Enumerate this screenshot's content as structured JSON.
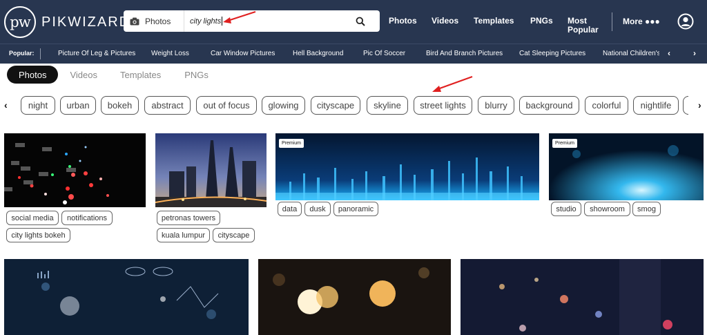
{
  "brand": {
    "logo_mark": "pw",
    "name": "PIKWIZARD"
  },
  "search": {
    "type_label": "Photos",
    "query": "city lights",
    "camera_icon": "camera-icon",
    "search_icon": "search-icon"
  },
  "nav": {
    "photos": "Photos",
    "videos": "Videos",
    "templates": "Templates",
    "pngs": "PNGs",
    "most_popular_1": "Most",
    "most_popular_2": "Popular",
    "more": "More ●●●",
    "user_icon": "user-account-icon"
  },
  "popular": {
    "label": "Popular:",
    "items": [
      "Picture Of Leg & Pictures",
      "Weight Loss",
      "Car Window Pictures",
      "Hell Background",
      "Pic Of Soccer",
      "Bird And Branch Pictures",
      "Cat Sleeping Pictures",
      "National Children's C"
    ],
    "prev": "‹",
    "next": "›"
  },
  "tabs": [
    "Photos",
    "Videos",
    "Templates",
    "PNGs"
  ],
  "chips": {
    "prev": "‹",
    "next": "›",
    "items": [
      "night",
      "urban",
      "bokeh",
      "abstract",
      "out of focus",
      "glowing",
      "cityscape",
      "skyline",
      "street lights",
      "blurry",
      "background",
      "colorful",
      "nightlife"
    ]
  },
  "photos": [
    {
      "premium": "",
      "tags": [
        "social media",
        "notifications",
        "city lights bokeh"
      ]
    },
    {
      "premium": "",
      "tags": [
        "petronas towers",
        "kuala lumpur",
        "cityscape"
      ]
    },
    {
      "premium": "Premium",
      "tags": [
        "data",
        "dusk",
        "panoramic"
      ]
    },
    {
      "premium": "Premium",
      "tags": [
        "studio",
        "showroom",
        "smog"
      ]
    }
  ],
  "colors": {
    "header_bg": "#283650",
    "annotation_arrow": "#e02020",
    "active_tab": "#111111"
  }
}
